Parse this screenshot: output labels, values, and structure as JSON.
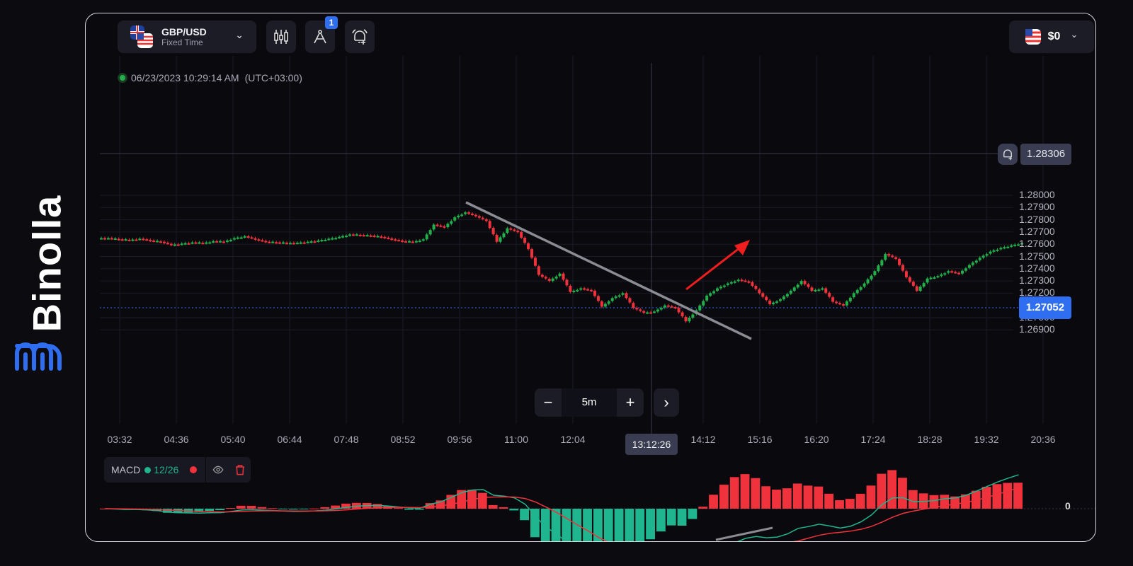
{
  "brand": {
    "name": "Binolla",
    "color": "#2f6ef0"
  },
  "toolbar": {
    "pair": "GBP/USD",
    "pair_type": "Fixed Time",
    "drawing_badge": "1",
    "balance": "$0"
  },
  "status": {
    "datetime": "06/23/2023 10:29:14 AM",
    "timezone": "(UTC+03:00)"
  },
  "price_axis": [
    "1.28000",
    "1.27900",
    "1.27800",
    "1.27700",
    "1.27600",
    "1.27500",
    "1.27400",
    "1.27300",
    "1.27200",
    "1.27000",
    "1.26900"
  ],
  "alert_price": "1.28306",
  "current_price": "1.27052",
  "time_axis": [
    "03:32",
    "04:36",
    "05:40",
    "06:44",
    "07:48",
    "08:52",
    "09:56",
    "11:00",
    "12:04",
    "14:12",
    "15:16",
    "16:20",
    "17:24",
    "18:28",
    "19:32",
    "20:36"
  ],
  "crosshair_time": "13:12:26",
  "zoom": {
    "minus": "−",
    "timeframe": "5m",
    "plus": "+",
    "next": "›"
  },
  "indicator": {
    "name": "MACD",
    "params": "12/26",
    "zero_label": "0"
  },
  "colors": {
    "up": "#22b04b",
    "down": "#f0323c",
    "accent": "#2f6ef0",
    "macd_line": "#1fb58f",
    "signal_line": "#f0323c"
  },
  "chart_data": {
    "type": "candlestick",
    "timeframe": "5m",
    "closes": [
      1.2765,
      1.2764,
      1.27635,
      1.27645,
      1.2763,
      1.2762,
      1.27595,
      1.27605,
      1.27615,
      1.2761,
      1.27625,
      1.2762,
      1.2765,
      1.27665,
      1.2764,
      1.2762,
      1.27615,
      1.2761,
      1.27612,
      1.2762,
      1.2763,
      1.27645,
      1.2766,
      1.2768,
      1.27675,
      1.2767,
      1.2766,
      1.2764,
      1.27625,
      1.2762,
      1.2764,
      1.2776,
      1.2774,
      1.2782,
      1.2786,
      1.2783,
      1.2779,
      1.2762,
      1.2773,
      1.277,
      1.2756,
      1.2735,
      1.273,
      1.2736,
      1.2721,
      1.2724,
      1.2722,
      1.2709,
      1.2716,
      1.272,
      1.2708,
      1.2704,
      1.2705,
      1.271,
      1.2708,
      1.2697,
      1.2706,
      1.2718,
      1.2724,
      1.2728,
      1.2731,
      1.2729,
      1.272,
      1.2711,
      1.2715,
      1.2722,
      1.273,
      1.2722,
      1.2724,
      1.2713,
      1.271,
      1.272,
      1.2728,
      1.2738,
      1.2752,
      1.2748,
      1.2733,
      1.2722,
      1.2732,
      1.2734,
      1.2738,
      1.2736,
      1.2743,
      1.2749,
      1.2754,
      1.2757,
      1.2759,
      1.2761
    ],
    "ylim": [
      1.269,
      1.28
    ]
  }
}
